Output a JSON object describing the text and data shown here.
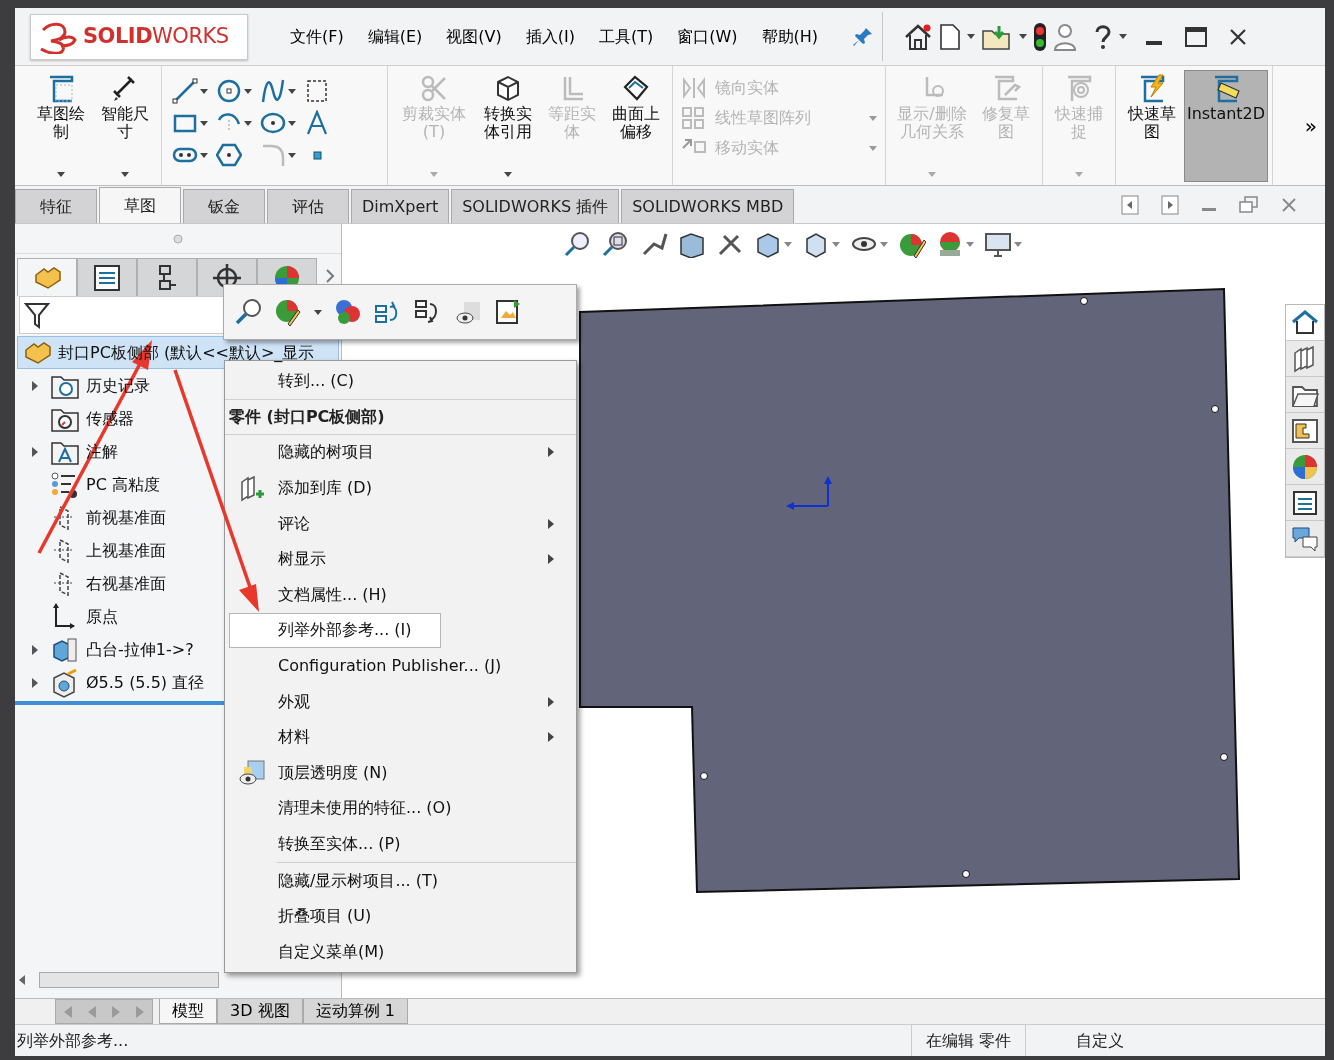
{
  "logo": {
    "text": "**SOLID**WORKS"
  },
  "menu_bar": [
    "文件(F)",
    "编辑(E)",
    "视图(V)",
    "插入(I)",
    "工具(T)",
    "窗口(W)",
    "帮助(H)"
  ],
  "ribbon": {
    "groups": [
      {
        "kind": "big",
        "items": [
          {
            "label": "草图绘制",
            "disabled": false,
            "pressed": false,
            "dropdown": true
          },
          {
            "label": "智能尺寸",
            "disabled": false,
            "pressed": false,
            "dropdown": true
          }
        ]
      },
      {
        "kind": "tools"
      },
      {
        "kind": "big",
        "items": [
          {
            "label": "剪裁实体(T)",
            "disabled": true,
            "pressed": false,
            "dropdown": true
          },
          {
            "label": "转换实体引用",
            "disabled": false,
            "pressed": false,
            "dropdown": true
          },
          {
            "label": "等距实体",
            "disabled": true,
            "pressed": false,
            "dropdown": false
          },
          {
            "label": "曲面上偏移",
            "disabled": false,
            "pressed": false,
            "dropdown": false
          }
        ]
      },
      {
        "kind": "list",
        "items": [
          {
            "label": "镜向实体",
            "disabled": true,
            "dropdown": false
          },
          {
            "label": "线性草图阵列",
            "disabled": true,
            "dropdown": true
          },
          {
            "label": "移动实体",
            "disabled": true,
            "dropdown": true
          }
        ]
      },
      {
        "kind": "big",
        "items": [
          {
            "label": "显示/删除几何关系",
            "disabled": true,
            "pressed": false,
            "dropdown": true
          },
          {
            "label": "修复草图",
            "disabled": true,
            "pressed": false,
            "dropdown": false
          }
        ]
      },
      {
        "kind": "big",
        "items": [
          {
            "label": "快速捕捉",
            "disabled": true,
            "pressed": false,
            "dropdown": true
          }
        ]
      },
      {
        "kind": "big",
        "items": [
          {
            "label": "快速草图",
            "disabled": false,
            "pressed": false,
            "dropdown": false
          },
          {
            "label": "Instant2D",
            "disabled": false,
            "pressed": true,
            "dropdown": false
          }
        ]
      }
    ],
    "overflow": "»"
  },
  "command_tabs": [
    {
      "label": "特征",
      "selected": false
    },
    {
      "label": "草图",
      "selected": true
    },
    {
      "label": "钣金",
      "selected": false
    },
    {
      "label": "评估",
      "selected": false
    },
    {
      "label": "DimXpert",
      "selected": false
    },
    {
      "label": "SOLIDWORKS 插件",
      "selected": false
    },
    {
      "label": "SOLIDWORKS MBD",
      "selected": false
    }
  ],
  "panel_tabs": [
    {
      "selected": true
    },
    {
      "selected": false
    },
    {
      "selected": false
    },
    {
      "selected": false
    },
    {
      "selected": false
    }
  ],
  "tree": {
    "label": "封口PC板侧部 (默认<<默认>_显示",
    "kind": "part",
    "selected": true,
    "children": [
      {
        "label": "历史记录",
        "kind": "history",
        "expandable": true,
        "selected": false
      },
      {
        "label": "传感器",
        "kind": "sensor",
        "expandable": false,
        "selected": false
      },
      {
        "label": "注解",
        "kind": "annotation",
        "expandable": true,
        "selected": false
      },
      {
        "label": "PC 高粘度",
        "kind": "material",
        "expandable": false,
        "selected": false
      },
      {
        "label": "前视基准面",
        "kind": "plane",
        "expandable": false,
        "selected": false
      },
      {
        "label": "上视基准面",
        "kind": "plane",
        "expandable": false,
        "selected": false
      },
      {
        "label": "右视基准面",
        "kind": "plane",
        "expandable": false,
        "selected": false
      },
      {
        "label": "原点",
        "kind": "origin",
        "expandable": false,
        "selected": false
      },
      {
        "label": "凸台-拉伸1->?",
        "kind": "extrude",
        "expandable": true,
        "selected": false
      },
      {
        "label": "Ø5.5 (5.5) 直径",
        "kind": "hole",
        "expandable": true,
        "selected": false
      }
    ]
  },
  "context_menu": [
    {
      "kind": "item",
      "label": "转到... (C)",
      "submenu": false,
      "has_icon": false,
      "selected": false
    },
    {
      "kind": "separator"
    },
    {
      "kind": "header",
      "label": "零件 (封口PC板侧部)"
    },
    {
      "kind": "separator"
    },
    {
      "kind": "item",
      "label": "隐藏的树项目",
      "submenu": true,
      "has_icon": false,
      "selected": false
    },
    {
      "kind": "item",
      "label": "添加到库 (D)",
      "submenu": false,
      "has_icon": true,
      "selected": false
    },
    {
      "kind": "item",
      "label": "评论",
      "submenu": true,
      "has_icon": false,
      "selected": false
    },
    {
      "kind": "item",
      "label": "树显示",
      "submenu": true,
      "has_icon": false,
      "selected": false
    },
    {
      "kind": "item",
      "label": "文档属性... (H)",
      "submenu": false,
      "has_icon": false,
      "selected": false
    },
    {
      "kind": "item",
      "label": "列举外部参考... (I)",
      "submenu": false,
      "has_icon": false,
      "selected": true
    },
    {
      "kind": "item",
      "label": "Configuration Publisher... (J)",
      "submenu": false,
      "has_icon": false,
      "selected": false
    },
    {
      "kind": "item",
      "label": "外观",
      "submenu": true,
      "has_icon": false,
      "selected": false
    },
    {
      "kind": "item",
      "label": "材料",
      "submenu": true,
      "has_icon": false,
      "selected": false
    },
    {
      "kind": "item",
      "label": "顶层透明度 (N)",
      "submenu": false,
      "has_icon": true,
      "selected": false
    },
    {
      "kind": "item",
      "label": "清理未使用的特征... (O)",
      "submenu": false,
      "has_icon": false,
      "selected": false
    },
    {
      "kind": "item",
      "label": "转换至实体... (P)",
      "submenu": false,
      "has_icon": false,
      "selected": false
    },
    {
      "kind": "separator"
    },
    {
      "kind": "item",
      "label": "隐藏/显示树项目... (T)",
      "submenu": false,
      "has_icon": false,
      "selected": false
    },
    {
      "kind": "item",
      "label": "折叠项目 (U)",
      "submenu": false,
      "has_icon": false,
      "selected": false
    },
    {
      "kind": "item",
      "label": "自定义菜单(M)",
      "submenu": false,
      "has_icon": false,
      "selected": false
    }
  ],
  "task_pane": [
    {
      "selected": true
    },
    {
      "selected": false
    },
    {
      "selected": false
    },
    {
      "selected": false
    },
    {
      "selected": false
    },
    {
      "selected": false
    },
    {
      "selected": false
    }
  ],
  "bottom_tabs": [
    {
      "label": "模型",
      "selected": true
    },
    {
      "label": "3D 视图",
      "selected": false
    },
    {
      "label": "运动算例 1",
      "selected": false
    }
  ],
  "status_bar": {
    "message": "列举外部参考...",
    "mode": "在编辑 零件",
    "custom": "自定义"
  }
}
